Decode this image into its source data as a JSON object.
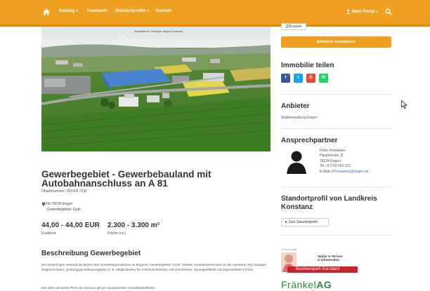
{
  "nav": {
    "items": [
      {
        "label": "Katalog",
        "dropdown": true
      },
      {
        "label": "Inserieren",
        "dropdown": false
      },
      {
        "label": "Standortprofile",
        "dropdown": true
      },
      {
        "label": "Kontakt",
        "dropdown": false
      }
    ],
    "portal_label": "Mein Portal",
    "caret": "▾"
  },
  "hero": {
    "caption": "Autobahn A1 Stuttgart-Singen/Schweiz"
  },
  "listing": {
    "title": "Gewerbegebiet - Gewerbebauland mit Autobahnanschluss an A 81",
    "object_number": "Objektnummer: 091009 7236",
    "location_line1": "DE-78234 Engen",
    "location_line2": "Gewerbegebiet: Grub",
    "price": "44,00 - 44,00 EUR",
    "price_label": "Kaufpreis",
    "area": "2.300 - 3.300 m²",
    "area_label": "Fläche (ca.)",
    "description_title": "Beschreibung Gewerbegebiet",
    "description": "Die Stadt Engen verkauft die letzten drei Gewerbegrundstücke im Engener Gewerbegebiet \"Grub\" direkter Autobahnanschluss an die Autobahn A81 Stuttgart-Singen/Schweiz, großzügiger Bebauungsplan (z. B. Möglichkeiten für 3-Schicht-Betrieb), voll erschlossen, Synergieeffekte mit angesiedelten Firmen",
    "description2": "Der oben genannte Preis von 44 Euro gilt pro Quadratmeter Grundstücksfläche."
  },
  "sidebar": {
    "print_label": "Drucken",
    "contact_button": "Anbieter kontaktieren",
    "share_title": "Immobilie teilen",
    "social": [
      {
        "icon": "facebook-icon",
        "glyph": "f",
        "color": "#3b5998"
      },
      {
        "icon": "twitter-icon",
        "glyph": "t",
        "color": "#1da1f2"
      },
      {
        "icon": "googleplus-icon",
        "glyph": "G",
        "color": "#dd4b39"
      },
      {
        "icon": "whatsapp-icon",
        "glyph": "W",
        "color": "#25d366"
      }
    ],
    "provider_title": "Anbieter",
    "provider_name": "Stadtverwaltung Engen",
    "contact_title": "Ansprechpartner",
    "contact": {
      "name": "Peter Freisleben",
      "street": "Hauptstraße 11",
      "city": "78234 Engen",
      "phone": "Tel.: 07733 502-212",
      "email_prefix": "E-Mail: ",
      "email": "PFreisleben@engen.de"
    },
    "standort_title": "Standortprofil von Landkreis Konstanz",
    "standort_button": "Zum Standortprofil"
  },
  "ad": {
    "label": "Werbeanzeige",
    "slogan_line1": "Spitze in Service",
    "slogan_line2": "& Infrastruktur",
    "banner": "Businesspark Konstanz",
    "brand": "Fränkel",
    "brand_suffix": "AG"
  },
  "colors": {
    "accent": "#f0a020",
    "text": "#333333",
    "link": "#3a6cc0"
  }
}
